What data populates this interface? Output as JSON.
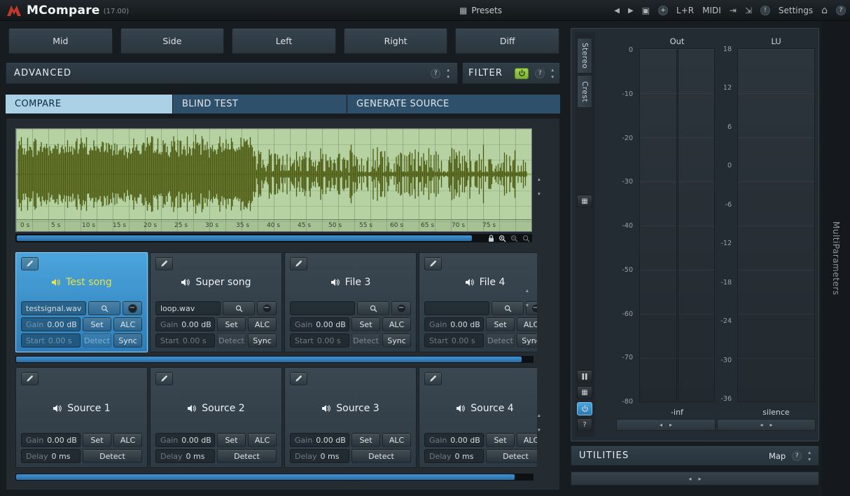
{
  "titlebar": {
    "app_name": "MCompare",
    "version": "(17.00)",
    "presets_label": "Presets",
    "channel_mode": "L+R",
    "midi_label": "MIDI",
    "settings_label": "Settings"
  },
  "channel_buttons": {
    "mid": "Mid",
    "side": "Side",
    "left": "Left",
    "right": "Right",
    "diff": "Diff"
  },
  "advanced": {
    "label": "ADVANCED"
  },
  "filter": {
    "label": "FILTER"
  },
  "tabs": {
    "compare": "COMPARE",
    "blind_test": "BLIND TEST",
    "generate_source": "GENERATE SOURCE"
  },
  "waveform": {
    "time_labels": [
      "0 s",
      "5 s",
      "10 s",
      "15 s",
      "20 s",
      "25 s",
      "30 s",
      "35 s",
      "40 s",
      "45 s",
      "50 s",
      "55 s",
      "60 s",
      "65 s",
      "70 s",
      "75 s"
    ]
  },
  "file_slots": [
    {
      "name": "Test song",
      "file": "testsignal.wav",
      "gain_label": "Gain",
      "gain_value": "0.00 dB",
      "set_label": "Set",
      "alc_label": "ALC",
      "start_label": "Start",
      "start_value": "0.00 s",
      "detect_label": "Detect",
      "sync_label": "Sync"
    },
    {
      "name": "Super song",
      "file": "loop.wav",
      "gain_label": "Gain",
      "gain_value": "0.00 dB",
      "set_label": "Set",
      "alc_label": "ALC",
      "start_label": "Start",
      "start_value": "0.00 s",
      "detect_label": "Detect",
      "sync_label": "Sync"
    },
    {
      "name": "File 3",
      "file": "",
      "gain_label": "Gain",
      "gain_value": "0.00 dB",
      "set_label": "Set",
      "alc_label": "ALC",
      "start_label": "Start",
      "start_value": "0.00 s",
      "detect_label": "Detect",
      "sync_label": "Sync"
    },
    {
      "name": "File 4",
      "file": "",
      "gain_label": "Gain",
      "gain_value": "0.00 dB",
      "set_label": "Set",
      "alc_label": "ALC",
      "start_label": "Start",
      "start_value": "0.00 s",
      "detect_label": "Detect",
      "sync_label": "Sync"
    }
  ],
  "source_slots": [
    {
      "name": "Source 1",
      "gain_label": "Gain",
      "gain_value": "0.00 dB",
      "set_label": "Set",
      "alc_label": "ALC",
      "delay_label": "Delay",
      "delay_value": "0 ms",
      "detect_label": "Detect"
    },
    {
      "name": "Source 2",
      "gain_label": "Gain",
      "gain_value": "0.00 dB",
      "set_label": "Set",
      "alc_label": "ALC",
      "delay_label": "Delay",
      "delay_value": "0 ms",
      "detect_label": "Detect"
    },
    {
      "name": "Source 3",
      "gain_label": "Gain",
      "gain_value": "0.00 dB",
      "set_label": "Set",
      "alc_label": "ALC",
      "delay_label": "Delay",
      "delay_value": "0 ms",
      "detect_label": "Detect"
    },
    {
      "name": "Source 4",
      "gain_label": "Gain",
      "gain_value": "0.00 dB",
      "set_label": "Set",
      "alc_label": "ALC",
      "delay_label": "Delay",
      "delay_value": "0 ms",
      "detect_label": "Detect"
    }
  ],
  "meters": {
    "out_label": "Out",
    "lu_label": "LU",
    "stereo_tab": "Stereo",
    "crest_tab": "Crest",
    "out_scale": [
      "0",
      "-10",
      "-20",
      "-30",
      "-40",
      "-50",
      "-60",
      "-70",
      "-80"
    ],
    "lu_scale": [
      "18",
      "12",
      "6",
      "0",
      "-6",
      "-12",
      "-18",
      "-24",
      "-30",
      "-36"
    ],
    "out_readout": "-inf",
    "lu_readout": "silence"
  },
  "utilities": {
    "label": "UTILITIES",
    "map_label": "Map"
  },
  "right_strip": {
    "label": "MultiParameters"
  },
  "icons": {
    "presets_grid": "▦",
    "back": "◀",
    "forward": "▶",
    "screenshot": "▣",
    "add": "+",
    "dock": "⇥",
    "copy": "⇲",
    "warning": "!",
    "home": "⌂",
    "help": "?",
    "minus": "−",
    "spin_up": "▴",
    "spin_down": "▾",
    "slider_left": "◂",
    "slider_right": "▸",
    "table": "▦",
    "routing": "▦"
  },
  "colors": {
    "accent_blue": "#3f9ad2",
    "power_green": "#8fc43f",
    "selected_tab_bg": "#abd1e7",
    "selected_slot_name": "#e8e447",
    "waveform_bg": "#b6d2a3",
    "waveform_ink": "#4e5c12",
    "scrollbar_blue": "#3f93d4"
  }
}
